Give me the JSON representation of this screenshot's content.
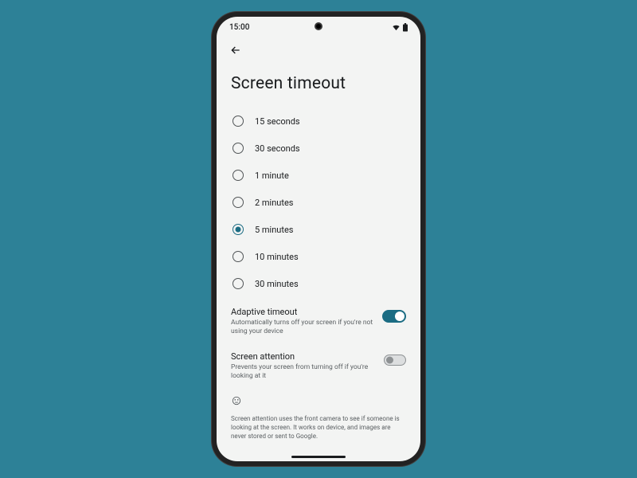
{
  "status": {
    "time": "15:00"
  },
  "page": {
    "title": "Screen timeout"
  },
  "timeout": {
    "selected_index": 4,
    "options": [
      {
        "label": "15 seconds"
      },
      {
        "label": "30 seconds"
      },
      {
        "label": "1 minute"
      },
      {
        "label": "2 minutes"
      },
      {
        "label": "5 minutes"
      },
      {
        "label": "10 minutes"
      },
      {
        "label": "30 minutes"
      }
    ]
  },
  "adaptive": {
    "title": "Adaptive timeout",
    "subtitle": "Automatically turns off your screen if you're not using your device",
    "enabled": true
  },
  "attention": {
    "title": "Screen attention",
    "subtitle": "Prevents your screen from turning off if you're looking at it",
    "enabled": false
  },
  "info": {
    "text": "Screen attention uses the front camera to see if someone is looking at the screen. It works on device, and images are never stored or sent to Google."
  },
  "colors": {
    "accent": "#1b6c83",
    "page_bg": "#2d8197",
    "screen_bg": "#f3f4f3"
  }
}
